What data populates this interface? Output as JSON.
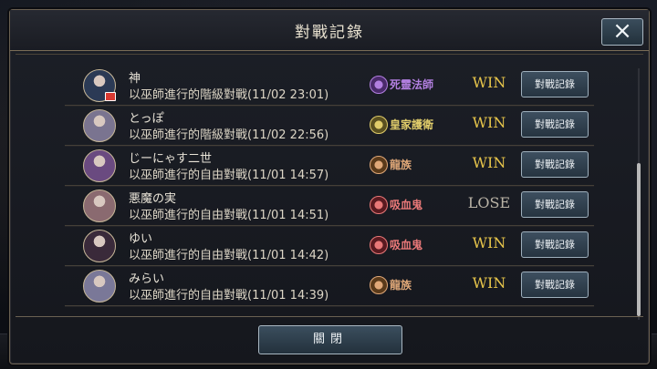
{
  "dialog": {
    "title": "對戰記錄",
    "close_icon": "×",
    "close_button_label": "關閉"
  },
  "colors": {
    "win": "#e7c54a",
    "lose": "#b9b3a6",
    "class_necromancer": "#a46ad6",
    "class_royal_guard": "#d8c060",
    "class_dragon": "#d8a070",
    "class_vampire": "#e07070"
  },
  "rows": [
    {
      "name": "神",
      "desc": "以巫師進行的階級對戰(11/02 23:01)",
      "class_icon": "skull-icon",
      "class_label": "死靈法師",
      "class_color": "#b27fe0",
      "icon_bg": "#4a2a6a",
      "result": "WIN",
      "result_type": "win",
      "button": "對戰記錄",
      "avatar_bg": "#2b3a55",
      "flag": true
    },
    {
      "name": "とっぽ",
      "desc": "以巫師進行的階級對戰(11/02 22:56)",
      "class_icon": "crown-icon",
      "class_label": "皇家護衛",
      "class_color": "#e0cc6a",
      "icon_bg": "#5a5020",
      "result": "WIN",
      "result_type": "win",
      "button": "對戰記錄",
      "avatar_bg": "#7a7490",
      "flag": false
    },
    {
      "name": "じーにゃす二世",
      "desc": "以巫師進行的自由對戰(11/01 14:57)",
      "class_icon": "dragon-icon",
      "class_label": "龍族",
      "class_color": "#e0a878",
      "icon_bg": "#5a3a1a",
      "result": "WIN",
      "result_type": "win",
      "button": "對戰記錄",
      "avatar_bg": "#6a4a80",
      "flag": false
    },
    {
      "name": "悪魔の実",
      "desc": "以巫師進行的自由對戰(11/01 14:51)",
      "class_icon": "vampire-icon",
      "class_label": "吸血鬼",
      "class_color": "#e87878",
      "icon_bg": "#5a1a20",
      "result": "LOSE",
      "result_type": "lose",
      "button": "對戰記錄",
      "avatar_bg": "#8a6a70",
      "flag": false
    },
    {
      "name": "ゆい",
      "desc": "以巫師進行的自由對戰(11/01 14:42)",
      "class_icon": "vampire-icon",
      "class_label": "吸血鬼",
      "class_color": "#e87878",
      "icon_bg": "#5a1a20",
      "result": "WIN",
      "result_type": "win",
      "button": "對戰記錄",
      "avatar_bg": "#3a2a3a",
      "flag": false
    },
    {
      "name": "みらい",
      "desc": "以巫師進行的自由對戰(11/01 14:39)",
      "class_icon": "dragon-icon",
      "class_label": "龍族",
      "class_color": "#e0a878",
      "icon_bg": "#5a3a1a",
      "result": "WIN",
      "result_type": "win",
      "button": "對戰記錄",
      "avatar_bg": "#7a7898",
      "flag": false
    }
  ]
}
